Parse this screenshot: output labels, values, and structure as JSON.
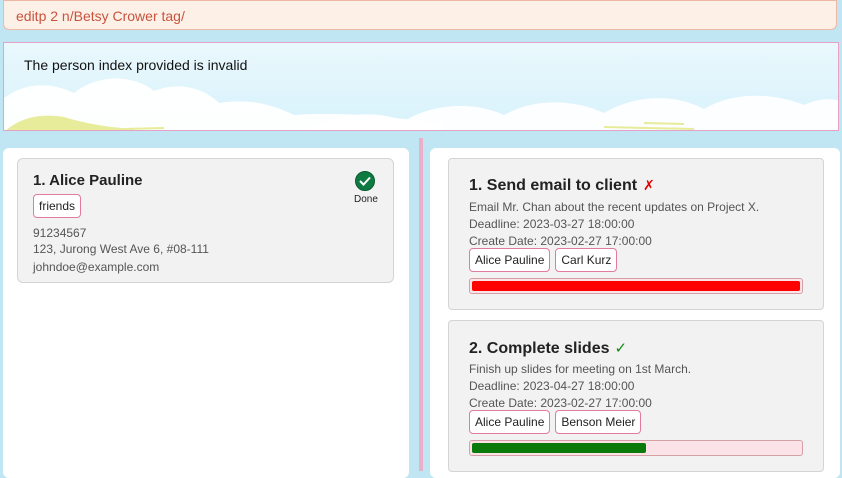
{
  "command": {
    "value": "editp 2 n/Betsy Crower tag/"
  },
  "result": {
    "message": "The person index provided is invalid"
  },
  "persons": [
    {
      "index_name": "1.  Alice Pauline",
      "tags": [
        "friends"
      ],
      "status_icon": "check-circle-icon",
      "status_label": "Done",
      "phone": "91234567",
      "address": "123, Jurong West Ave 6, #08-111",
      "email": "johndoe@example.com"
    }
  ],
  "tasks": [
    {
      "title": "1.  Send email to client",
      "status_mark": "✗",
      "status_icon": "cross-icon",
      "description": "Email Mr. Chan about the recent updates on Project X.",
      "deadline": "Deadline: 2023-03-27 18:00:00",
      "create_date": "Create Date: 2023-02-27 17:00:00",
      "assignees": [
        "Alice Pauline",
        "Carl Kurz"
      ],
      "progress": 1.0,
      "progress_color": "#ff0000"
    },
    {
      "title": "2.  Complete slides",
      "status_mark": "✓",
      "status_icon": "tick-icon",
      "description": "Finish up slides for meeting on 1st March.",
      "deadline": "Deadline: 2023-04-27 18:00:00",
      "create_date": "Create Date: 2023-02-27 17:00:00",
      "assignees": [
        "Alice Pauline",
        "Benson Meier"
      ],
      "progress": 0.53,
      "progress_color": "#0b7a0b"
    }
  ],
  "colors": {
    "command_text": "#c9533f",
    "accent_pink": "#e37aa0",
    "done_green": "#0e7a42"
  }
}
